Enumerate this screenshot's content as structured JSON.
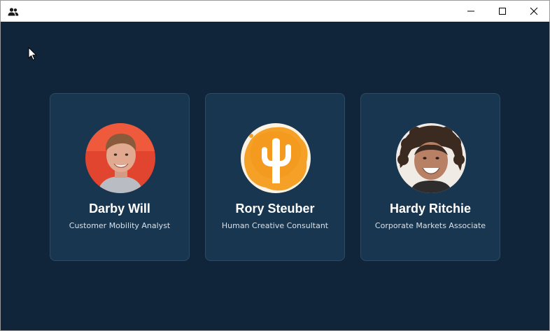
{
  "window": {
    "title_icon": "people-icon",
    "controls": {
      "minimize": "minimize-icon",
      "maximize": "maximize-icon",
      "close": "close-icon"
    }
  },
  "theme": {
    "background": "#10243a",
    "card_background": "#18364f",
    "card_border": "#2c4b66",
    "text_primary": "#ffffff",
    "text_secondary": "#d7e0e8"
  },
  "people": [
    {
      "name": "Darby Will",
      "role": "Customer Mobility Analyst",
      "avatar": "avatar-photo-man-red-background"
    },
    {
      "name": "Rory Steuber",
      "role": "Human Creative Consultant",
      "avatar": "avatar-cactus-orange"
    },
    {
      "name": "Hardy Ritchie",
      "role": "Corporate Markets Associate",
      "avatar": "avatar-photo-man-curly-hair"
    }
  ]
}
